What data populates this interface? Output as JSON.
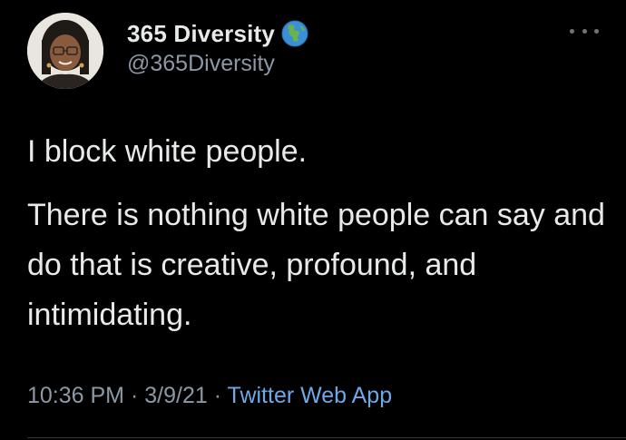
{
  "author": {
    "display_name": "365 Diversity",
    "handle": "@365Diversity",
    "badge_icon": "globe-icon",
    "avatar_icon": "avatar"
  },
  "tweet": {
    "paragraphs": [
      "I block white people.",
      "There is nothing white people can say and do that is creative, profound, and intimidating."
    ]
  },
  "meta": {
    "time": "10:36 PM",
    "separator": "·",
    "date": "3/9/21",
    "source": "Twitter Web App"
  },
  "more_menu": {
    "icon": "more-options-icon"
  },
  "colors": {
    "background": "#000000",
    "text": "#e7e9ea",
    "secondary_text": "#8b98a5",
    "link": "#6fa8e6"
  }
}
